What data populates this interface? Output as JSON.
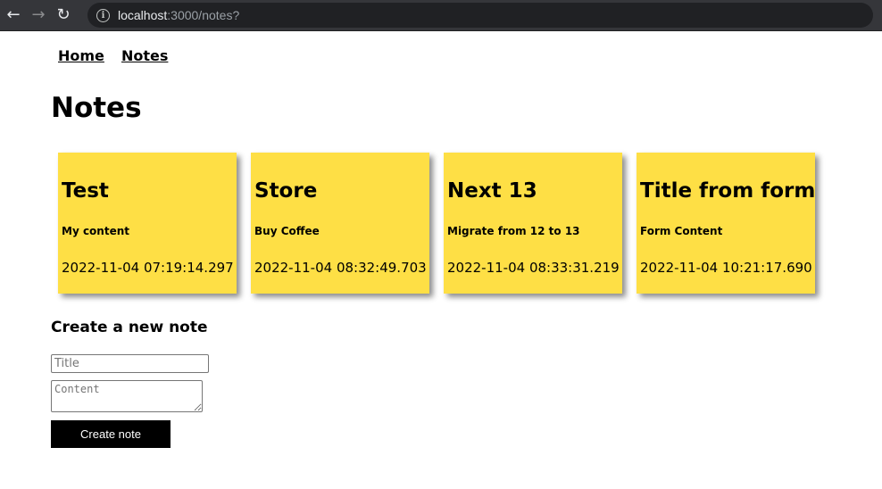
{
  "browser": {
    "back_icon": "←",
    "forward_icon": "→",
    "reload_icon": "↻",
    "info_icon": "i",
    "url_host": "localhost",
    "url_path": ":3000/notes?"
  },
  "nav": {
    "home": "Home",
    "notes": "Notes"
  },
  "page_title": "Notes",
  "notes": [
    {
      "title": "Test",
      "content": "My content",
      "date": "2022-11-04 07:19:14.297"
    },
    {
      "title": "Store",
      "content": "Buy Coffee",
      "date": "2022-11-04 08:32:49.703"
    },
    {
      "title": "Next 13",
      "content": "Migrate from 12 to 13",
      "date": "2022-11-04 08:33:31.219"
    },
    {
      "title": "Title from form",
      "content": "Form Content",
      "date": "2022-11-04 10:21:17.690"
    }
  ],
  "form": {
    "heading": "Create a new note",
    "title_placeholder": "Title",
    "title_value": "",
    "content_placeholder": "Content",
    "content_value": "",
    "submit_label": "Create note"
  },
  "colors": {
    "card_background": "#fedf45",
    "button_background": "#000000",
    "chrome_background": "#35363a"
  }
}
